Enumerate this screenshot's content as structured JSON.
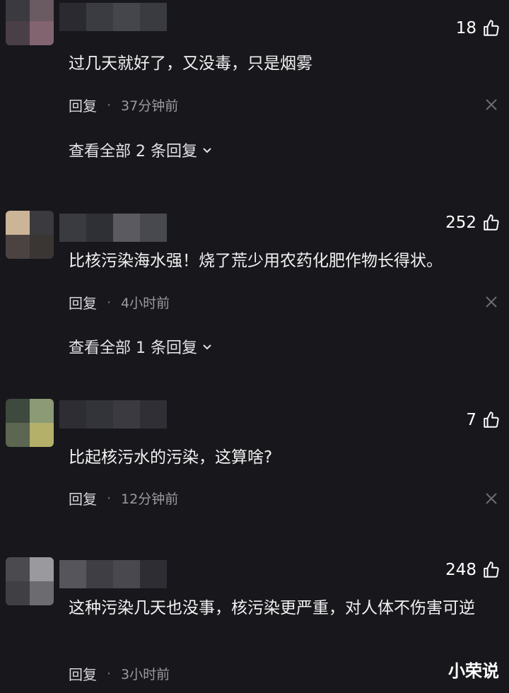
{
  "colors": {
    "background": "#17171c",
    "text": "#f2f2f2",
    "meta": "#9a9aa0"
  },
  "icons": {
    "like": "thumbs-up-icon",
    "dismiss": "close-icon",
    "expand": "chevron-down-icon"
  },
  "comments": [
    {
      "likes": "18",
      "text": "过几天就好了，又没毒，只是烟雾",
      "reply_label": "回复",
      "separator": "·",
      "time": "37分钟前",
      "view_replies": "查看全部 2 条回复"
    },
    {
      "likes": "252",
      "text": "比核污染海水强！烧了荒少用农药化肥作物长得状。",
      "reply_label": "回复",
      "separator": "·",
      "time": "4小时前",
      "view_replies": "查看全部 1 条回复"
    },
    {
      "likes": "7",
      "text": "比起核污水的污染，这算啥?",
      "reply_label": "回复",
      "separator": "·",
      "time": "12分钟前"
    },
    {
      "likes": "248",
      "text": "这种污染几天也没事，核污染更严重，对人体不伤害可逆",
      "reply_label": "回复",
      "separator": "·",
      "time": "3小时前"
    }
  ],
  "watermark": "小荣说"
}
